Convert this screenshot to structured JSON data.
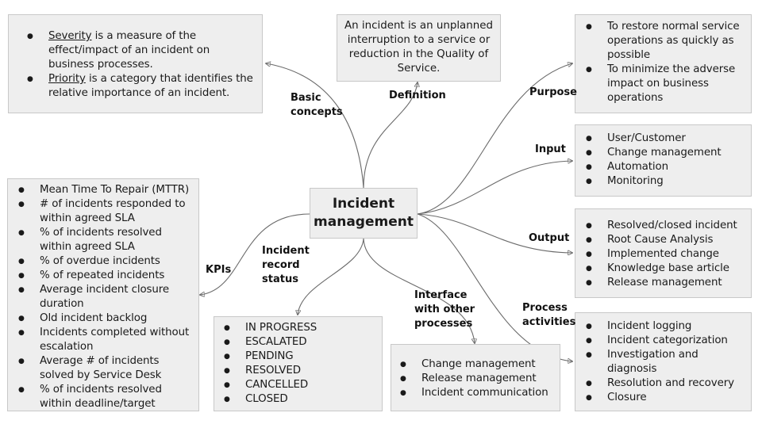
{
  "central": {
    "title_line1": "Incident",
    "title_line2": "management"
  },
  "branches": {
    "basic_concepts": {
      "label_line1": "Basic",
      "label_line2": "concepts",
      "items": [
        {
          "term": "Severity",
          "text": " is a measure of the effect/impact of an incident on business processes."
        },
        {
          "term": "Priority",
          "text": " is a category that identifies the relative importance of an incident."
        }
      ]
    },
    "definition": {
      "label": "Definition",
      "text": "An incident is an unplanned interruption to a service or reduction in the Quality of Service."
    },
    "purpose": {
      "label": "Purpose",
      "items": [
        "To restore normal service operations as quickly as possible",
        "To minimize the adverse impact on business operations"
      ]
    },
    "input": {
      "label": "Input",
      "items": [
        "User/Customer",
        "Change management",
        "Automation",
        "Monitoring"
      ]
    },
    "output": {
      "label": "Output",
      "items": [
        "Resolved/closed incident",
        "Root Cause Analysis",
        "Implemented change",
        "Knowledge base article",
        "Release management"
      ]
    },
    "process_activities": {
      "label_line1": "Process",
      "label_line2": "activities",
      "items": [
        "Incident logging",
        "Incident categorization",
        "Investigation and diagnosis",
        "Resolution and recovery",
        "Closure"
      ]
    },
    "interface": {
      "label_line1": "Interface",
      "label_line2": "with other",
      "label_line3": "processes",
      "items": [
        "Change management",
        "Release management",
        "Incident communication"
      ]
    },
    "record_status": {
      "label_line1": "Incident",
      "label_line2": "record",
      "label_line3": "status",
      "items": [
        "IN PROGRESS",
        "ESCALATED",
        "PENDING",
        "RESOLVED",
        "CANCELLED",
        "CLOSED"
      ]
    },
    "kpis": {
      "label": "KPIs",
      "items": [
        "Mean Time To Repair (MTTR)",
        "# of incidents responded to within agreed SLA",
        "% of incidents resolved within agreed SLA",
        "% of overdue incidents",
        "% of repeated incidents",
        "Average incident closure duration",
        "Old incident backlog",
        "Incidents completed without escalation",
        "Average # of incidents solved by Service Desk",
        "% of incidents resolved within deadline/target"
      ]
    }
  },
  "colors": {
    "box_fill": "#eeeeee",
    "box_border": "#c8c8c8",
    "connector": "#6a6a6a"
  }
}
